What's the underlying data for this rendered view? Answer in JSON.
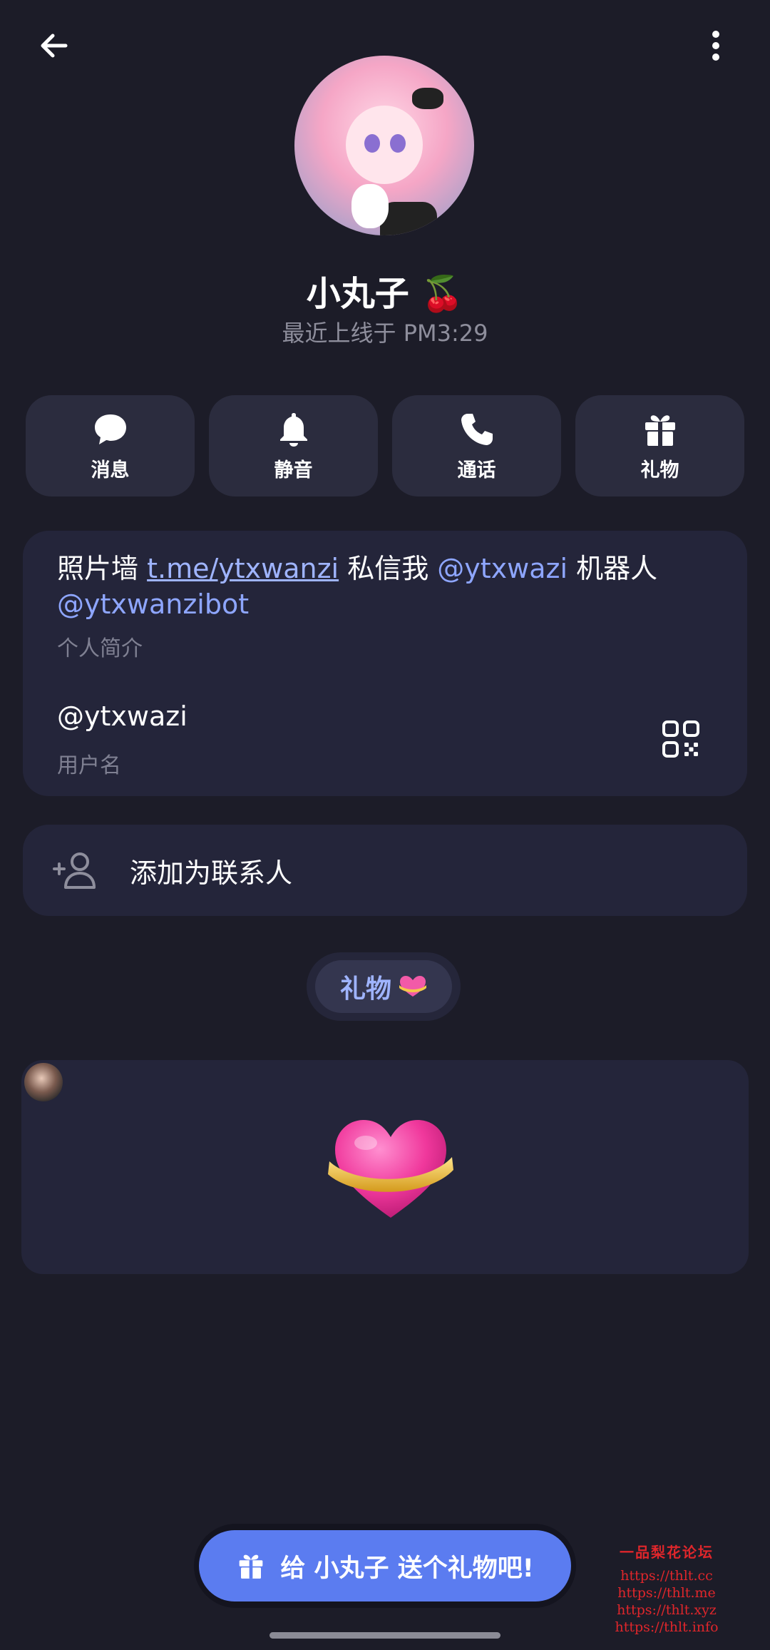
{
  "profile": {
    "name": "小丸子",
    "name_emoji": "🍒",
    "status": "最近上线于 PM3:29"
  },
  "actions": [
    {
      "label": "消息",
      "icon": "chat-bubble-icon"
    },
    {
      "label": "静音",
      "icon": "bell-icon"
    },
    {
      "label": "通话",
      "icon": "phone-icon"
    },
    {
      "label": "礼物",
      "icon": "gift-icon"
    }
  ],
  "info": {
    "bio_prefix": "照片墙 ",
    "bio_link": "t.me/ytxwanzi",
    "bio_mid": " 私信我 ",
    "bio_mention1": "@ytxwazi",
    "bio_mid2": " 机器人 ",
    "bio_mention2": "@ytxwanzibot",
    "bio_label": "个人简介",
    "username": "@ytxwazi",
    "username_label": "用户名"
  },
  "contact": {
    "label": "添加为联系人"
  },
  "gifts_section": {
    "chip_label": "礼物"
  },
  "cta": {
    "label": "给 小丸子 送个礼物吧!"
  },
  "watermark": {
    "title": "一品梨花论坛",
    "lines": [
      "https://thlt.cc",
      "https://thlt.me",
      "https://thlt.xyz",
      "https://thlt.info"
    ]
  },
  "colors": {
    "background": "#1c1c28",
    "card": "#24253a",
    "accent": "#5b7cf0",
    "link": "#8ea6ff"
  }
}
